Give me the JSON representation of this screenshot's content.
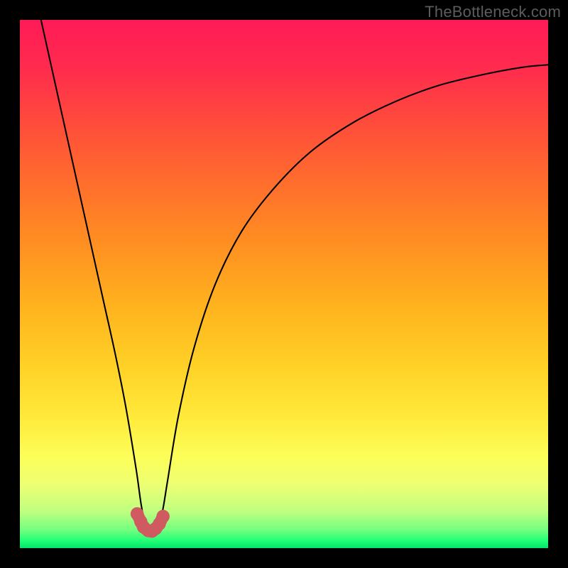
{
  "watermark": "TheBottleneck.com",
  "chart_data": {
    "type": "line",
    "title": "",
    "xlabel": "",
    "ylabel": "",
    "xlim": [
      0,
      100
    ],
    "ylim": [
      0,
      100
    ],
    "series": [
      {
        "name": "bottleneck-curve",
        "x": [
          4,
          6,
          8,
          10,
          12,
          14,
          16,
          18,
          20,
          22,
          23,
          24,
          25,
          26,
          27,
          28,
          30,
          33,
          37,
          42,
          48,
          55,
          63,
          71,
          79,
          87,
          95,
          100
        ],
        "values": [
          100,
          91,
          82,
          73,
          64,
          55,
          46,
          37,
          27,
          15,
          8,
          3.5,
          3,
          3.5,
          7,
          13,
          25,
          38,
          50,
          60,
          68,
          75,
          80.5,
          84.5,
          87.5,
          89.5,
          91,
          91.5
        ]
      }
    ],
    "gradient_stops": [
      {
        "offset": 0,
        "color": "#ff1a57"
      },
      {
        "offset": 0.09,
        "color": "#ff2b4e"
      },
      {
        "offset": 0.19,
        "color": "#ff4a3c"
      },
      {
        "offset": 0.3,
        "color": "#ff6b2d"
      },
      {
        "offset": 0.42,
        "color": "#ff8e22"
      },
      {
        "offset": 0.54,
        "color": "#ffb21e"
      },
      {
        "offset": 0.65,
        "color": "#ffd026"
      },
      {
        "offset": 0.75,
        "color": "#ffe93a"
      },
      {
        "offset": 0.83,
        "color": "#fcff5a"
      },
      {
        "offset": 0.88,
        "color": "#edff74"
      },
      {
        "offset": 0.93,
        "color": "#c0ff80"
      },
      {
        "offset": 0.965,
        "color": "#75ff80"
      },
      {
        "offset": 0.985,
        "color": "#24ff77"
      },
      {
        "offset": 1.0,
        "color": "#00e66a"
      }
    ],
    "marker": {
      "color": "#cf5a60",
      "points_x": [
        22.2,
        22.9,
        23.4,
        24.3,
        25.0,
        25.7,
        26.4,
        27.1
      ],
      "points_y": [
        6.5,
        5.0,
        4.0,
        3.3,
        3.2,
        3.7,
        4.6,
        6.0
      ]
    }
  }
}
